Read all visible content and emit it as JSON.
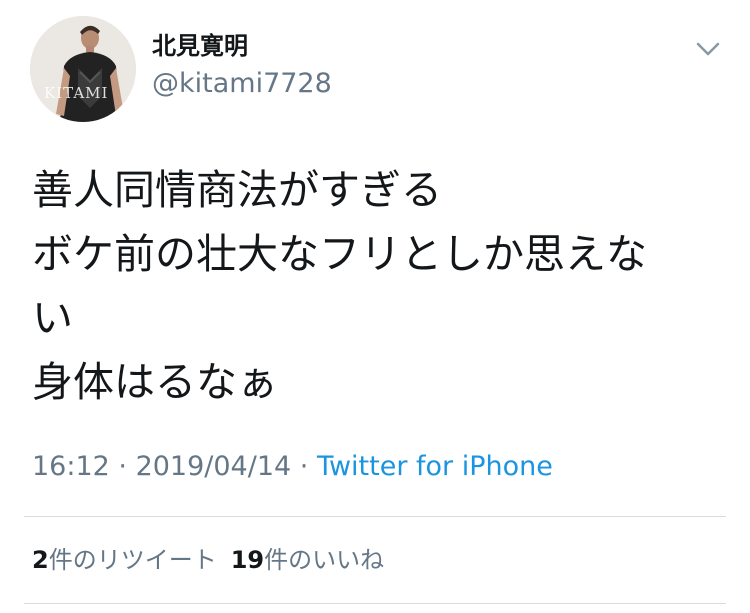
{
  "user": {
    "display_name": "北見寛明",
    "handle": "@kitami7728",
    "avatar_caption": "KITAMI"
  },
  "tweet": {
    "lines": [
      "善人同情商法がすぎる",
      "ボケ前の壮大なフリとしか思えな",
      "い",
      "身体はるなぁ"
    ]
  },
  "meta": {
    "time": "16:12",
    "separator": " · ",
    "date": "2019/04/14",
    "source": "Twitter for iPhone"
  },
  "stats": {
    "retweet_count": "2",
    "retweet_label": "件のリツイート",
    "like_count": "19",
    "like_label": "件のいいね"
  },
  "icons": {
    "menu": "chevron-down-icon"
  },
  "colors": {
    "text": "#14171a",
    "secondary": "#657786",
    "link": "#1b95e0",
    "divider": "#d8dde2"
  }
}
